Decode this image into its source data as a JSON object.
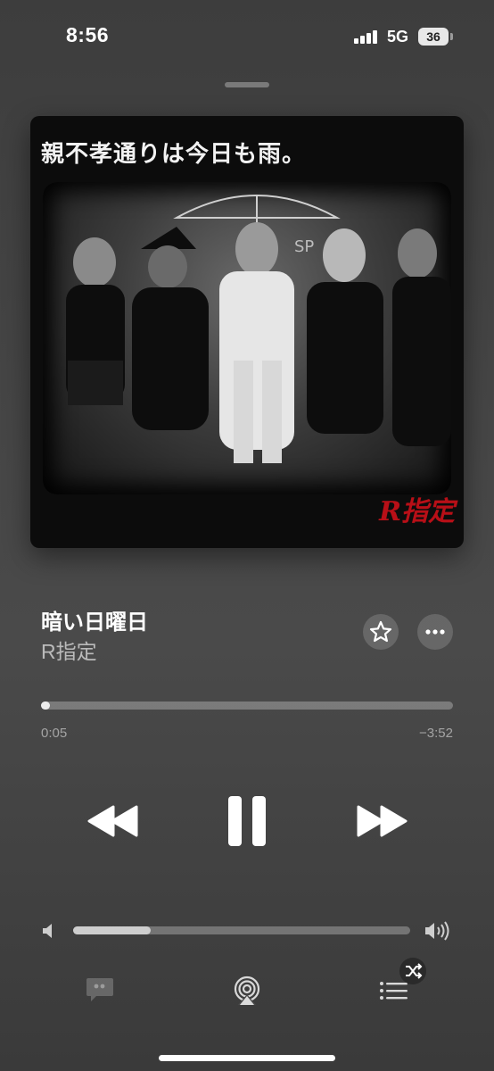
{
  "status_bar": {
    "time": "8:56",
    "network": "5G",
    "battery": "36"
  },
  "artwork": {
    "caption": "親不孝通りは今日も雨。",
    "logo": "R指定"
  },
  "track": {
    "title": "暗い日曜日",
    "artist": "R指定"
  },
  "progress": {
    "elapsed": "0:05",
    "remaining": "−3:52",
    "fraction": 0.022
  },
  "volume": {
    "level": 0.23
  },
  "colors": {
    "background": "#444444",
    "accent": "#ffffff",
    "logo_red": "#b80f17"
  },
  "icons": {
    "favorite": "star-icon",
    "more": "ellipsis-icon",
    "rewind": "backward-icon",
    "pause": "pause-icon",
    "forward": "forward-icon",
    "volume_low": "speaker-low-icon",
    "volume_high": "speaker-high-icon",
    "lyrics": "lyrics-bubble-icon",
    "airplay": "airplay-icon",
    "queue": "queue-list-icon",
    "shuffle": "shuffle-icon"
  }
}
